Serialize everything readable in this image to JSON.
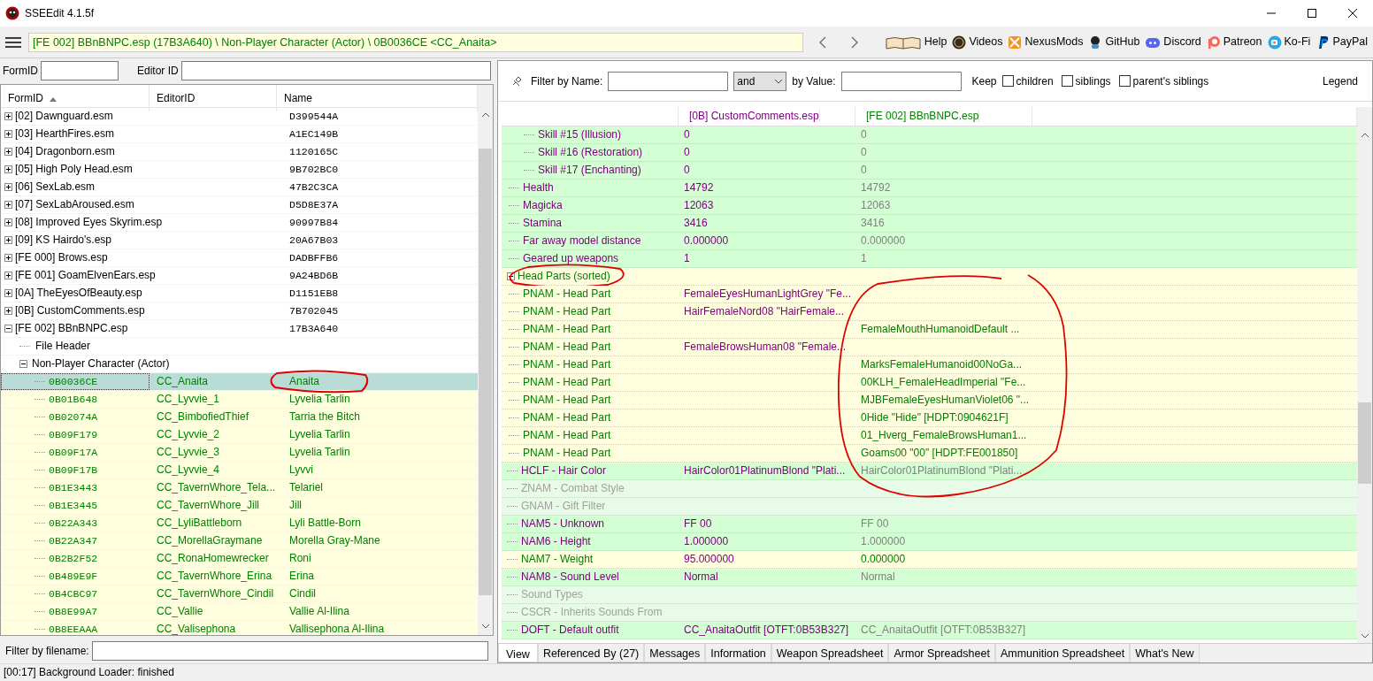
{
  "window": {
    "title": "SSEEdit 4.1.5f"
  },
  "toolbar": {
    "path": "[FE 002] BBnBNPC.esp (17B3A640) \\ Non-Player Character (Actor) \\ 0B0036CE <CC_Anaita>",
    "links": [
      {
        "kind": "help",
        "label": "Help"
      },
      {
        "kind": "videos",
        "label": "Videos"
      },
      {
        "kind": "nexus",
        "label": "NexusMods"
      },
      {
        "kind": "github",
        "label": "GitHub"
      },
      {
        "kind": "discord",
        "label": "Discord"
      },
      {
        "kind": "patreon",
        "label": "Patreon"
      },
      {
        "kind": "kofi",
        "label": "Ko-Fi"
      },
      {
        "kind": "paypal",
        "label": "PayPal"
      }
    ]
  },
  "left_filters": {
    "formid_label": "FormID",
    "editorid_label": "Editor ID"
  },
  "tree": {
    "columns": [
      {
        "label": "FormID",
        "sorted": true
      },
      {
        "label": "EditorID",
        "sorted": false
      },
      {
        "label": "Name",
        "sorted": false
      }
    ],
    "items": [
      {
        "kind": "plugin",
        "label": "[02] Dawnguard.esm",
        "name": "D399544A",
        "expanded": false
      },
      {
        "kind": "plugin",
        "label": "[03] HearthFires.esm",
        "name": "A1EC149B",
        "expanded": false
      },
      {
        "kind": "plugin",
        "label": "[04] Dragonborn.esm",
        "name": "1120165C",
        "expanded": false
      },
      {
        "kind": "plugin",
        "label": "[05] High Poly Head.esm",
        "name": "9B702BC0",
        "expanded": false
      },
      {
        "kind": "plugin",
        "label": "[06] SexLab.esm",
        "name": "47B2C3CA",
        "expanded": false
      },
      {
        "kind": "plugin",
        "label": "[07] SexLabAroused.esm",
        "name": "D5D8E37A",
        "expanded": false
      },
      {
        "kind": "plugin",
        "label": "[08] Improved Eyes Skyrim.esp",
        "name": "90997B84",
        "expanded": false
      },
      {
        "kind": "plugin",
        "label": "[09] KS Hairdo's.esp",
        "name": "20A67B03",
        "expanded": false
      },
      {
        "kind": "plugin",
        "label": "[FE 000] Brows.esp",
        "name": "DADBFFB6",
        "expanded": false
      },
      {
        "kind": "plugin",
        "label": "[FE 001] GoamElvenEars.esp",
        "name": "9A24BD6B",
        "expanded": false
      },
      {
        "kind": "plugin",
        "label": "[0A] TheEyesOfBeauty.esp",
        "name": "D1151EB8",
        "expanded": false
      },
      {
        "kind": "plugin",
        "label": "[0B] CustomComments.esp",
        "name": "7B702045",
        "expanded": false
      },
      {
        "kind": "plugin",
        "label": "[FE 002] BBnBNPC.esp",
        "name": "17B3A640",
        "expanded": true,
        "children": [
          {
            "kind": "group",
            "label": "File Header"
          },
          {
            "kind": "group",
            "label": "Non-Player Character (Actor)",
            "expanded": true,
            "children": [
              {
                "kind": "record",
                "formid": "0B0036CE",
                "editor_id": "CC_Anaita",
                "name": "Anaita",
                "selected": true,
                "circled": true
              },
              {
                "kind": "record",
                "formid": "0B01B648",
                "editor_id": "CC_Lyvvie_1",
                "name": "Lyvelia Tarlin",
                "selected": false,
                "circled": false
              },
              {
                "kind": "record",
                "formid": "0B02074A",
                "editor_id": "CC_BimbofiedThief",
                "name": "Tarria the Bitch",
                "selected": false,
                "circled": false
              },
              {
                "kind": "record",
                "formid": "0B09F179",
                "editor_id": "CC_Lyvvie_2",
                "name": "Lyvelia Tarlin",
                "selected": false,
                "circled": false
              },
              {
                "kind": "record",
                "formid": "0B09F17A",
                "editor_id": "CC_Lyvvie_3",
                "name": "Lyvelia Tarlin",
                "selected": false,
                "circled": false
              },
              {
                "kind": "record",
                "formid": "0B09F17B",
                "editor_id": "CC_Lyvvie_4",
                "name": "Lyvvi",
                "selected": false,
                "circled": false
              },
              {
                "kind": "record",
                "formid": "0B1E3443",
                "editor_id": "CC_TavernWhore_Tela...",
                "name": "Telariel",
                "selected": false,
                "circled": false
              },
              {
                "kind": "record",
                "formid": "0B1E3445",
                "editor_id": "CC_TavernWhore_Jill",
                "name": "Jill",
                "selected": false,
                "circled": false
              },
              {
                "kind": "record",
                "formid": "0B22A343",
                "editor_id": "CC_LyliBattleborn",
                "name": "Lyli Battle-Born",
                "selected": false,
                "circled": false
              },
              {
                "kind": "record",
                "formid": "0B22A347",
                "editor_id": "CC_MorellaGraymane",
                "name": "Morella Gray-Mane",
                "selected": false,
                "circled": false
              },
              {
                "kind": "record",
                "formid": "0B2B2F52",
                "editor_id": "CC_RonaHomewrecker",
                "name": "Roni",
                "selected": false,
                "circled": false
              },
              {
                "kind": "record",
                "formid": "0B489E9F",
                "editor_id": "CC_TavernWhore_Erina",
                "name": "Erina",
                "selected": false,
                "circled": false
              },
              {
                "kind": "record",
                "formid": "0B4CBC97",
                "editor_id": "CC_TavernWhore_Cindil",
                "name": "Cindil",
                "selected": false,
                "circled": false
              },
              {
                "kind": "record",
                "formid": "0B8E99A7",
                "editor_id": "CC_Vallie",
                "name": "Vallie Al-Ilina",
                "selected": false,
                "circled": false
              },
              {
                "kind": "record",
                "formid": "0B8EEAAA",
                "editor_id": "CC_Valisephona",
                "name": "Vallisephona Al-Ilina",
                "selected": false,
                "circled": false
              }
            ]
          }
        ]
      }
    ]
  },
  "filename_filter": {
    "label": "Filter by filename:"
  },
  "status_bar": "[00:17] Background Loader: finished",
  "record_filter": {
    "name_label": "Filter by Name:",
    "operator": "and",
    "value_label": "by Value:",
    "keep_label": "Keep",
    "options": [
      {
        "label": "children",
        "checked": false
      },
      {
        "label": "siblings",
        "checked": false
      },
      {
        "label": "parent's siblings",
        "checked": false
      }
    ],
    "legend": "Legend"
  },
  "record": {
    "columns": [
      {
        "label": "[0B] CustomComments.esp",
        "color": "#800080"
      },
      {
        "label": "[FE 002] BBnBNPC.esp",
        "color": "#008000"
      }
    ],
    "rows": [
      {
        "kind": "continuation",
        "children": [
          {
            "kind": "continuation",
            "children": [
              {
                "label": "Skill #15 (Illusion)",
                "kind": "override",
                "value_1": "0",
                "value_2": "0"
              },
              {
                "label": "Skill #16 (Restoration)",
                "kind": "override",
                "value_1": "0",
                "value_2": "0"
              },
              {
                "label": "Skill #17 (Enchanting)",
                "kind": "override",
                "value_1": "0",
                "value_2": "0"
              }
            ]
          },
          {
            "label": "Health",
            "kind": "override",
            "value_1": "14792",
            "value_2": "14792"
          },
          {
            "label": "Magicka",
            "kind": "override",
            "value_1": "12063",
            "value_2": "12063"
          },
          {
            "label": "Stamina",
            "kind": "override",
            "value_1": "3416",
            "value_2": "3416"
          },
          {
            "label": "Far away model distance",
            "kind": "override",
            "value_1": "0.000000",
            "value_2": "0.000000"
          },
          {
            "label": "Geared up weapons",
            "kind": "override",
            "value_1": "1",
            "value_2": "1"
          }
        ]
      },
      {
        "label": "Head Parts (sorted)",
        "kind": "conflict",
        "expanded": true,
        "circled": true,
        "values_circled": true,
        "children": [
          {
            "label": "PNAM - Head Part",
            "kind": "conflict",
            "value_1": "FemaleEyesHumanLightGrey \"Fe..."
          },
          {
            "label": "PNAM - Head Part",
            "kind": "conflict",
            "value_1": "HairFemaleNord08 \"HairFemale..."
          },
          {
            "label": "PNAM - Head Part",
            "kind": "conflict",
            "value_2": "FemaleMouthHumanoidDefault ..."
          },
          {
            "label": "PNAM - Head Part",
            "kind": "conflict",
            "value_1": "FemaleBrowsHuman08 \"Female..."
          },
          {
            "label": "PNAM - Head Part",
            "kind": "conflict",
            "value_2": "MarksFemaleHumanoid00NoGa..."
          },
          {
            "label": "PNAM - Head Part",
            "kind": "conflict",
            "value_2": "00KLH_FemaleHeadImperial \"Fe..."
          },
          {
            "label": "PNAM - Head Part",
            "kind": "conflict",
            "value_2": "MJBFemaleEyesHumanViolet06 \"..."
          },
          {
            "label": "PNAM - Head Part",
            "kind": "conflict",
            "value_2": "0Hide \"Hide\" [HDPT:0904621F]"
          },
          {
            "label": "PNAM - Head Part",
            "kind": "conflict",
            "value_2": "01_Hverg_FemaleBrowsHuman1..."
          },
          {
            "label": "PNAM - Head Part",
            "kind": "conflict",
            "value_2": "Goams00 \"00\" [HDPT:FE001850]"
          }
        ]
      },
      {
        "label": "HCLF - Hair Color",
        "kind": "override",
        "value_1": "HairColor01PlatinumBlond \"Plati...",
        "value_2": "HairColor01PlatinumBlond \"Plati..."
      },
      {
        "label": "ZNAM - Combat Style",
        "kind": "empty"
      },
      {
        "label": "GNAM - Gift Filter",
        "kind": "empty"
      },
      {
        "label": "NAM5 - Unknown",
        "kind": "override",
        "value_1": "FF 00",
        "value_2": "FF 00"
      },
      {
        "label": "NAM6 - Height",
        "kind": "override",
        "value_1": "1.000000",
        "value_2": "1.000000"
      },
      {
        "label": "NAM7 - Weight",
        "kind": "conflict",
        "value_1": "95.000000",
        "value_2": "0.000000"
      },
      {
        "label": "NAM8 - Sound Level",
        "kind": "override",
        "value_1": "Normal",
        "value_2": "Normal"
      },
      {
        "label": "Sound Types",
        "kind": "empty"
      },
      {
        "label": "CSCR - Inherits Sounds From",
        "kind": "empty"
      },
      {
        "label": "DOFT - Default outfit",
        "kind": "override",
        "value_1": "CC_AnaitaOutfit [OTFT:0B53B327]",
        "value_2": "CC_AnaitaOutfit [OTFT:0B53B327]"
      }
    ]
  },
  "tabs": [
    {
      "label": "View",
      "selected": true
    },
    {
      "label": "Referenced By (27)",
      "selected": false
    },
    {
      "label": "Messages",
      "selected": false
    },
    {
      "label": "Information",
      "selected": false
    },
    {
      "label": "Weapon Spreadsheet",
      "selected": false
    },
    {
      "label": "Armor Spreadsheet",
      "selected": false
    },
    {
      "label": "Ammunition Spreadsheet",
      "selected": false
    },
    {
      "label": "What's New",
      "selected": false
    }
  ]
}
